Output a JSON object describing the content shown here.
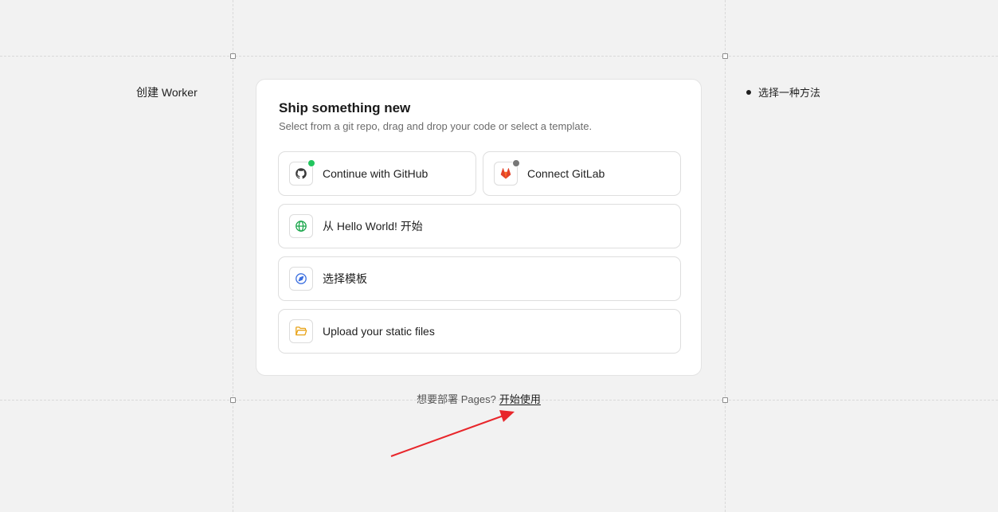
{
  "left_label": "创建 Worker",
  "steps": [
    {
      "label": "选择一种方法"
    }
  ],
  "card": {
    "title": "Ship something new",
    "subtitle": "Select from a git repo, drag and drop your code or select a template."
  },
  "options": {
    "github": {
      "label": "Continue with GitHub",
      "icon": "github-icon",
      "status_color": "#22c55e"
    },
    "gitlab": {
      "label": "Connect GitLab",
      "icon": "gitlab-icon",
      "status_color": "#777777"
    },
    "hello_world": {
      "label": "从 Hello World! 开始",
      "icon": "globe-icon"
    },
    "template": {
      "label": "选择模板",
      "icon": "compass-icon"
    },
    "upload": {
      "label": "Upload your static files",
      "icon": "folder-icon"
    }
  },
  "footer": {
    "prompt": "想要部署 Pages?",
    "link": "开始使用"
  },
  "colors": {
    "background": "#f2f2f2",
    "card": "#ffffff",
    "annotation_arrow": "#e8262b",
    "globe": "#1aa64b",
    "compass": "#3b6fe0",
    "folder": "#e8a317",
    "gitlab": "#e2432a"
  }
}
